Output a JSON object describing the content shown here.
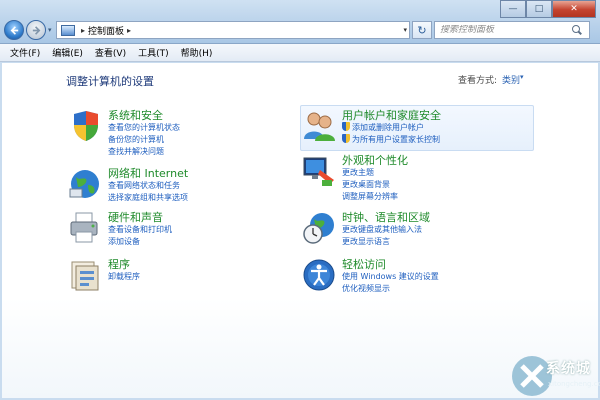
{
  "window": {
    "close_symbol": "✕",
    "minimize_symbol": "—",
    "maximize_symbol": "□"
  },
  "address": {
    "crumb": "控制面板",
    "sep1": "▸",
    "sep2": "▸",
    "dropdown": "▾",
    "refresh": "↻",
    "history": "▾"
  },
  "search": {
    "placeholder": "搜索控制面板"
  },
  "menu": [
    "文件(F)",
    "编辑(E)",
    "查看(V)",
    "工具(T)",
    "帮助(H)"
  ],
  "page": {
    "title": "调整计算机的设置",
    "view_label": "查看方式:",
    "view_value": "类别",
    "view_caret": "▾"
  },
  "categories": [
    {
      "title": "系统和安全",
      "links": [
        "查看您的计算机状态",
        "备份您的计算机",
        "查找并解决问题"
      ],
      "icon": "shield-computer-icon"
    },
    {
      "title": "网络和 Internet",
      "links": [
        "查看网络状态和任务",
        "选择家庭组和共享选项"
      ],
      "icon": "network-globe-icon"
    },
    {
      "title": "硬件和声音",
      "links": [
        "查看设备和打印机",
        "添加设备"
      ],
      "icon": "printer-icon"
    },
    {
      "title": "程序",
      "links": [
        "卸载程序"
      ],
      "icon": "programs-icon"
    },
    {
      "title": "用户帐户和家庭安全",
      "links": [
        "添加或删除用户帐户",
        "为所有用户设置家长控制"
      ],
      "icon": "users-icon"
    },
    {
      "title": "外观和个性化",
      "links": [
        "更改主题",
        "更改桌面背景",
        "调整屏幕分辨率"
      ],
      "icon": "monitor-palette-icon"
    },
    {
      "title": "时钟、语言和区域",
      "links": [
        "更改键盘或其他输入法",
        "更改显示语言"
      ],
      "icon": "clock-globe-icon"
    },
    {
      "title": "轻松访问",
      "links": [
        "使用 Windows 建议的设置",
        "优化视频显示"
      ],
      "icon": "ease-of-access-icon"
    }
  ],
  "watermark": {
    "text": "系统城",
    "sub": "xitongcheng.com"
  },
  "colors": {
    "category_title": "#1e8a2a",
    "link": "#1f5fbf",
    "chrome": "#b8d1ea"
  }
}
